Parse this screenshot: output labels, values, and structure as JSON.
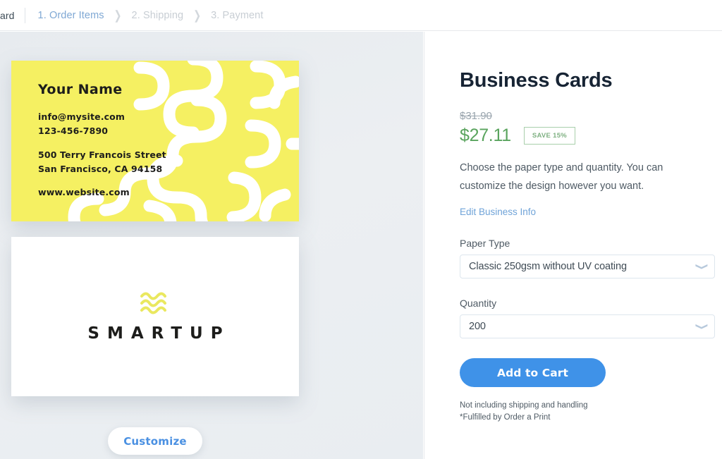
{
  "breadcrumb": {
    "truncated_prefix": "ard",
    "separator_icon": "chevron-right-icon",
    "steps": [
      {
        "label": "1. Order Items",
        "state": "active"
      },
      {
        "label": "2. Shipping",
        "state": "inactive"
      },
      {
        "label": "3. Payment",
        "state": "inactive"
      }
    ]
  },
  "preview": {
    "front": {
      "name": "Your Name",
      "email": "info@mysite.com",
      "phone": "123-456-7890",
      "address_line1": "500 Terry Francois Street",
      "address_line2": "San Francisco, CA 94158",
      "website": "www.website.com",
      "background_color": "#f5f062",
      "pattern_color": "#ffffff"
    },
    "back": {
      "logo_icon": "wavy-lines-logo-icon",
      "logo_text": "SMARTUP",
      "logo_mark_color": "#eae85f",
      "background_color": "#ffffff"
    },
    "customize_label": "Customize"
  },
  "product": {
    "title": "Business Cards",
    "price_original": "$31.90",
    "price_current": "$27.11",
    "save_badge": "SAVE 15%",
    "description": "Choose the paper type and quantity. You can customize the design however you want.",
    "edit_link": "Edit Business Info",
    "paper_type": {
      "label": "Paper Type",
      "value": "Classic 250gsm without UV coating",
      "chevron_icon": "chevron-down-icon"
    },
    "quantity": {
      "label": "Quantity",
      "value": "200",
      "chevron_icon": "chevron-down-icon"
    },
    "cta_label": "Add to Cart",
    "fineprint_line1": "Not including shipping and handling",
    "fineprint_line2": "*Fulfilled by Order a Print"
  },
  "colors": {
    "accent_blue": "#3f92e8",
    "link_blue": "#6fa3d8",
    "price_green": "#5aa45e",
    "card_yellow": "#f5f062",
    "pane_bg": "#e9edf1"
  }
}
